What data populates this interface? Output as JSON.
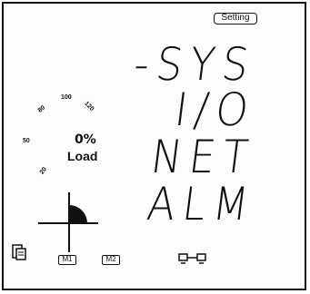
{
  "header": {
    "setting_label": "Setting"
  },
  "menu": {
    "items": [
      {
        "label": "-SYS"
      },
      {
        "label": "I/O"
      },
      {
        "label": "NET"
      },
      {
        "label": "ALM"
      }
    ]
  },
  "gauge": {
    "ticks": [
      "20",
      "50",
      "80",
      "100",
      "120"
    ],
    "load_percent": "0%",
    "load_label": "Load"
  },
  "status_bar": {
    "m1_label": "M1",
    "m2_label": "M2"
  },
  "icons": {
    "quadrant": "power-quadrant-icon",
    "device": "device-icon",
    "network": "network-link-icon"
  },
  "colors": {
    "segment": "#111111",
    "background": "#fdfdfd"
  }
}
